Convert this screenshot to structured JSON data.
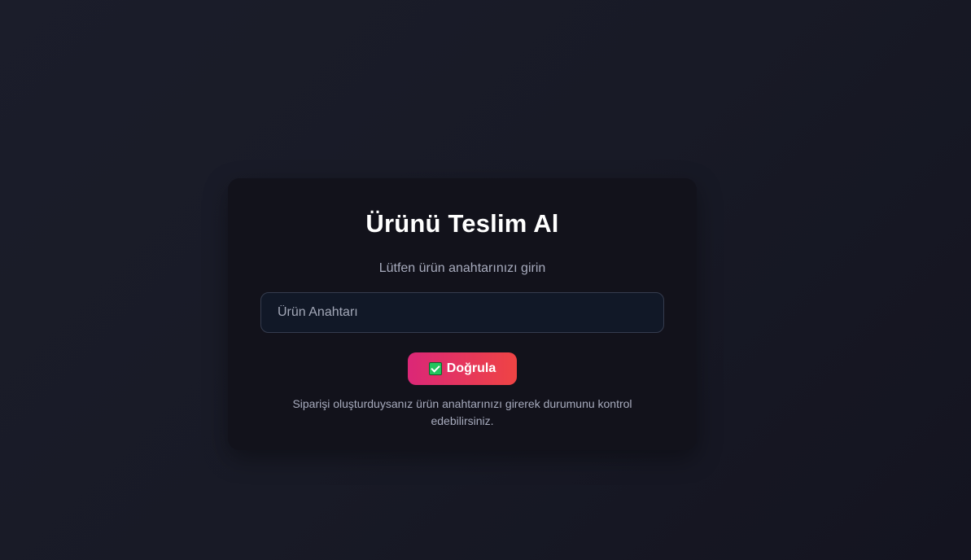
{
  "card": {
    "title": "Ürünü Teslim Al",
    "subtitle": "Lütfen ürün anahtarınızı girin",
    "key_input": {
      "placeholder": "Ürün Anahtarı",
      "value": ""
    },
    "verify_button": {
      "icon": "check-mark-icon",
      "label": "Doğrula"
    },
    "help_text": "Siparişi oluşturduysanız ürün anahtarınızı girerek durumunu kontrol edebilirsiniz."
  },
  "colors": {
    "background": "#1b1d2a",
    "card": "#12121b",
    "button_gradient_start": "#db2777",
    "button_gradient_end": "#ef4444",
    "check_icon": "#22c55e"
  }
}
